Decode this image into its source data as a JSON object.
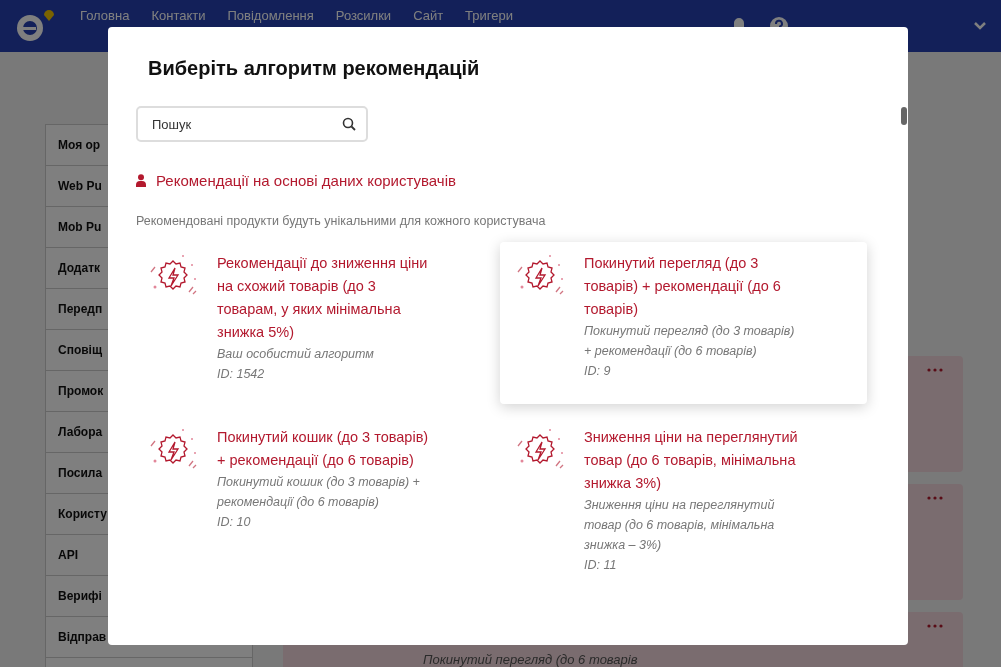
{
  "header": {
    "nav": [
      "Головна",
      "Контакти",
      "Повідомлення",
      "Розсилки",
      "Сайт",
      "Тригери"
    ]
  },
  "sidebar": {
    "items": [
      "Моя ор",
      "Web Pu",
      "Mob Pu",
      "Додатк",
      "Передп",
      "Сповіщ",
      "Промок",
      "Лабора",
      "Посила",
      "Користу",
      "API",
      "Верифі",
      "Відправ"
    ]
  },
  "background_cards": {
    "last_card_text": "Покинутий перегляд (до 6 товарів"
  },
  "modal": {
    "title": "Виберіть алгоритм рекомендацій",
    "search": {
      "placeholder": "Пошук"
    },
    "section": {
      "heading": "Рекомендації на основі даних користувачів",
      "description": "Рекомендовані продукти будуть унікальними для кожного користувача"
    },
    "algorithms": [
      {
        "title": "Рекомендації до зниження ціни на схожий товарів (до 3 товарам, у яких мінімальна знижка 5%)",
        "description": "Ваш особистий алгоритм",
        "id": "ID: 1542",
        "highlighted": false
      },
      {
        "title": "Покинутий перегляд (до 3 товарів) + рекомендації (до 6 товарів)",
        "description": "Покинутий перегляд (до 3 товарів) + рекомендації (до 6 товарів)",
        "id": "ID: 9",
        "highlighted": true
      },
      {
        "title": "Покинутий кошик (до 3 товарів) + рекомендації (до 6 товарів)",
        "description": "Покинутий кошик (до 3 товарів) + рекомендації (до 6 товарів)",
        "id": "ID: 10",
        "highlighted": false
      },
      {
        "title": "Зниження ціни на переглянутий товар (до 6 товарів, мінімальна знижка 3%)",
        "description": "Зниження ціни на переглянутий товар (до 6 товарів, мінімальна знижка – 3%)",
        "id": "ID: 11",
        "highlighted": false
      }
    ]
  }
}
